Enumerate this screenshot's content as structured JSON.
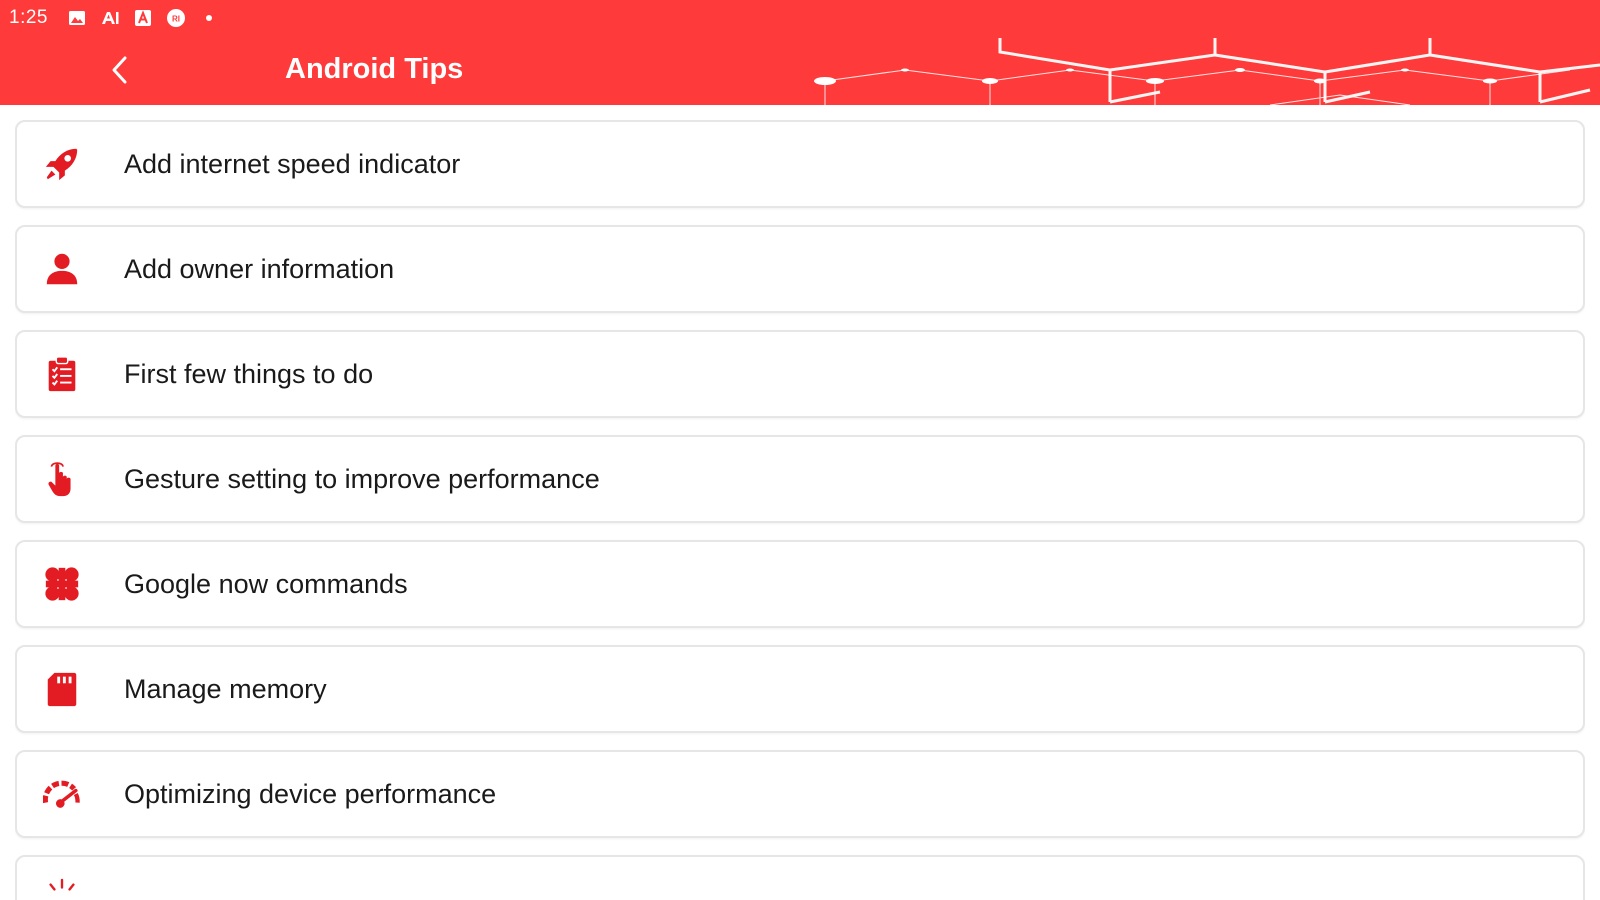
{
  "status_bar": {
    "time": "1:25",
    "icons": [
      "image-icon",
      "ai-icon",
      "font-icon",
      "app-badge-icon",
      "dot-icon"
    ]
  },
  "app_bar": {
    "title": "Android Tips",
    "back_icon": "chevron-left-icon"
  },
  "colors": {
    "accent": "#ff3a3a",
    "icon": "#e31c23",
    "text": "#1a1a1a",
    "card_border": "#e6e6e6"
  },
  "tips": [
    {
      "label": "Add internet speed indicator",
      "icon": "rocket-icon"
    },
    {
      "label": "Add owner information",
      "icon": "person-icon"
    },
    {
      "label": "First few things to do",
      "icon": "clipboard-checklist-icon"
    },
    {
      "label": "Gesture setting to improve performance",
      "icon": "pointing-hand-icon"
    },
    {
      "label": "Google now commands",
      "icon": "command-key-icon"
    },
    {
      "label": "Manage memory",
      "icon": "sd-card-icon"
    },
    {
      "label": "Optimizing device performance",
      "icon": "speedometer-icon"
    },
    {
      "label": "",
      "icon": "sparkle-icon"
    }
  ]
}
